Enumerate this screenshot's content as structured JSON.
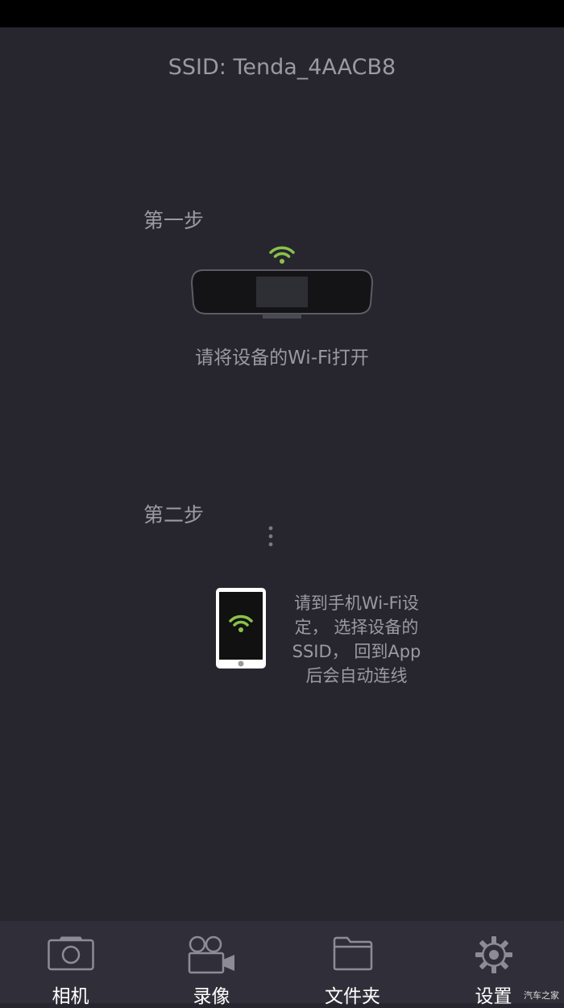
{
  "header": {
    "ssid": "SSID: Tenda_4AACB8"
  },
  "step1": {
    "title": "第一步",
    "text": "请将设备的Wi-Fi打开"
  },
  "step2": {
    "title": "第二步",
    "text_lines": [
      "请到手机Wi-Fi设",
      "定， 选择设备的",
      "SSID， 回到App",
      "后会自动连线"
    ]
  },
  "tabs": [
    {
      "label": "相机",
      "icon": "camera-icon"
    },
    {
      "label": "录像",
      "icon": "video-camera-icon"
    },
    {
      "label": "文件夹",
      "icon": "folder-icon"
    },
    {
      "label": "设置",
      "icon": "gear-icon"
    }
  ],
  "watermark": "汽车之家",
  "colors": {
    "background": "#27262f",
    "tabbar": "#302f39",
    "wifi": "#8ac24a",
    "text": "#9a9aa0"
  }
}
